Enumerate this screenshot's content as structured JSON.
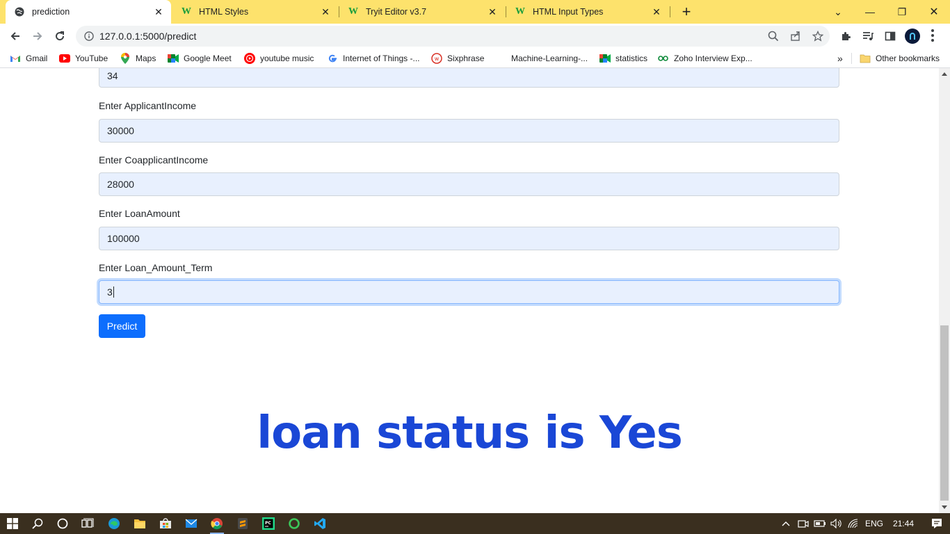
{
  "browser": {
    "tabs": [
      {
        "title": "prediction",
        "icon": "globe-icon",
        "active": true
      },
      {
        "title": "HTML Styles",
        "icon": "w3schools-icon",
        "active": false
      },
      {
        "title": "Tryit Editor v3.7",
        "icon": "w3schools-icon",
        "active": false
      },
      {
        "title": "HTML Input Types",
        "icon": "w3schools-icon",
        "active": false
      }
    ],
    "tab_close_glyph": "✕",
    "new_tab_glyph": "+",
    "window_controls": {
      "dropdown": "⌄",
      "minimize": "—",
      "restore": "❐",
      "close": "✕"
    },
    "url": "127.0.0.1:5000/predict"
  },
  "bookmarks": [
    {
      "label": "Gmail",
      "icon": "gmail-icon"
    },
    {
      "label": "YouTube",
      "icon": "youtube-icon"
    },
    {
      "label": "Maps",
      "icon": "maps-icon"
    },
    {
      "label": "Google Meet",
      "icon": "meet-icon"
    },
    {
      "label": "youtube music",
      "icon": "youtube-music-icon"
    },
    {
      "label": "Internet of Things -...",
      "icon": "google-icon"
    },
    {
      "label": "Sixphrase",
      "icon": "sixphrase-icon"
    },
    {
      "label": "Machine-Learning-...",
      "icon": "none"
    },
    {
      "label": "statistics",
      "icon": "meet-icon"
    },
    {
      "label": "Zoho Interview Exp...",
      "icon": "zoho-icon"
    }
  ],
  "bookmarks_more": "»",
  "other_bookmarks": "Other bookmarks",
  "form": {
    "partial_value": "34",
    "fields": [
      {
        "label": "Enter ApplicantIncome",
        "value": "30000"
      },
      {
        "label": "Enter CoapplicantIncome",
        "value": "28000"
      },
      {
        "label": "Enter LoanAmount",
        "value": "100000"
      },
      {
        "label": "Enter Loan_Amount_Term",
        "value": "3"
      }
    ],
    "submit_label": "Predict"
  },
  "result_text": "loan status is Yes",
  "colors": {
    "tabstrip": "#fde26c",
    "input_bg": "#e8f0fe",
    "button": "#0d6efd",
    "result": "#1a47d6",
    "taskbar": "#3a2f1f"
  },
  "taskbar": {
    "apps": [
      "windows-start-icon",
      "search-icon",
      "cortana-icon",
      "task-view-icon",
      "edge-icon",
      "file-explorer-icon",
      "store-icon",
      "mail-icon",
      "chrome-icon",
      "sublime-icon",
      "pycharm-icon",
      "circle-app-icon",
      "vscode-icon"
    ],
    "language": "ENG",
    "time": "21:44"
  }
}
